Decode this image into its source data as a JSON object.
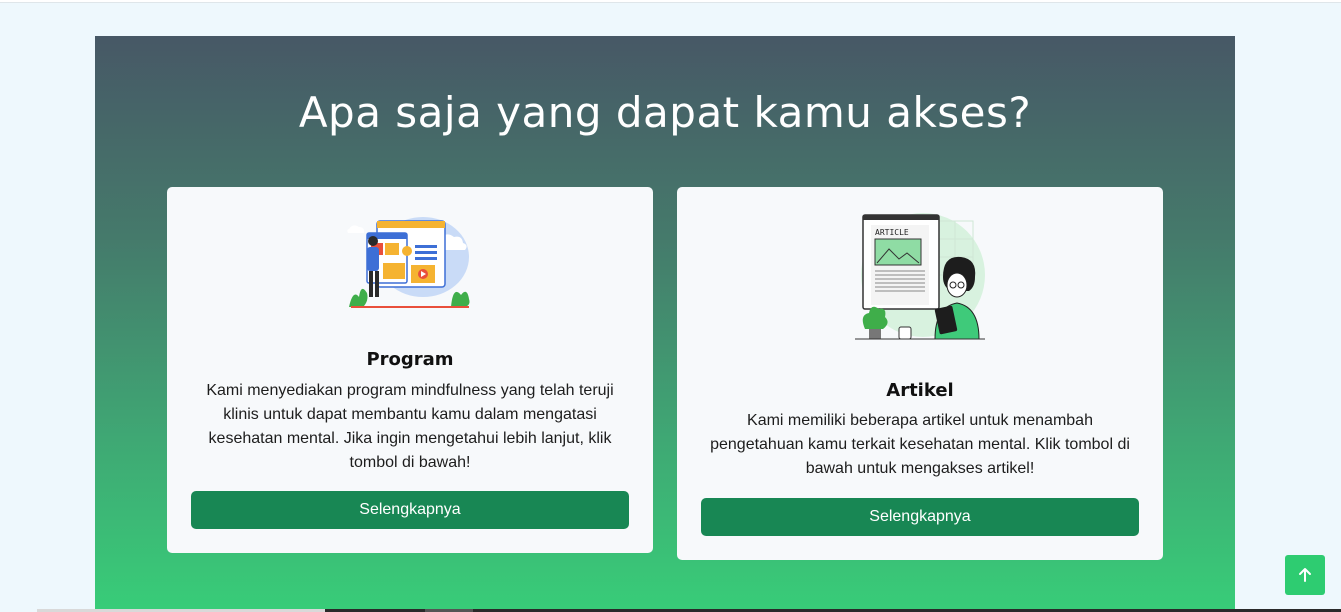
{
  "section": {
    "title": "Apa saja yang dapat kamu akses?"
  },
  "cards": [
    {
      "heading": "Program",
      "description": "Kami menyediakan program mindfulness yang telah teruji klinis untuk dapat membantu kamu dalam mengatasi kesehatan mental. Jika ingin mengetahui lebih lanjut, klik tombol di bawah!",
      "button_label": "Selengkapnya",
      "illustration": "video-content-illustration"
    },
    {
      "heading": "Artikel",
      "description": "Kami memiliki beberapa artikel untuk menambah pengetahuan kamu terkait kesehatan mental. Klik tombol di bawah untuk mengakses artikel!",
      "button_label": "Selengkapnya",
      "illustration": "article-reading-illustration",
      "illustration_text": "ARTICLE"
    }
  ],
  "scroll_top": {
    "icon": "arrow-up-icon"
  },
  "colors": {
    "accent": "#188754",
    "scroll_button": "#2ecc71",
    "gradient_top": "#475866",
    "gradient_bottom": "#38cd78"
  }
}
